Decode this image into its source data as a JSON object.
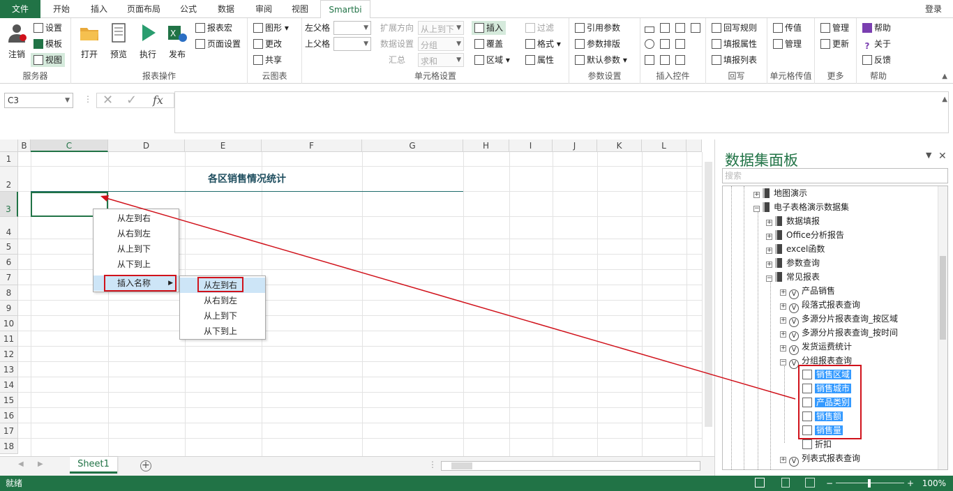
{
  "menu_tabs": [
    "文件",
    "开始",
    "插入",
    "页面布局",
    "公式",
    "数据",
    "审阅",
    "视图",
    "Smartbi"
  ],
  "login_label": "登录",
  "ribbon": {
    "server": {
      "label": "服务器",
      "login": "注销",
      "settings": "设置",
      "template": "模板",
      "view": "视图"
    },
    "report_ops": {
      "label": "报表操作",
      "open": "打开",
      "preview": "预览",
      "run": "执行",
      "publish": "发布",
      "macro": "报表宏",
      "page_setup": "页面设置"
    },
    "cloud": {
      "label": "云图表",
      "chart": "图形",
      "change": "更改",
      "share": "共享"
    },
    "cell_settings": {
      "label": "单元格设置",
      "left_parent": "左父格",
      "top_parent": "上父格",
      "expand_dir": "扩展方向",
      "expand_dir_value": "从上到下",
      "data_setting": "数据设置",
      "data_setting_value": "分组",
      "summary": "汇总",
      "summary_value": "求和",
      "insert": "插入",
      "cover": "覆盖",
      "area": "区域",
      "filter": "过滤",
      "format": "格式",
      "property": "属性"
    },
    "params": {
      "label": "参数设置",
      "ref_param": "引用参数",
      "param_layout": "参数排版",
      "default_param": "默认参数"
    },
    "controls": {
      "label": "插入控件"
    },
    "writeback": {
      "label": "回写",
      "rule": "回写规则",
      "fill_property": "填报属性",
      "fill_list": "填报列表"
    },
    "cell_passing": {
      "label": "单元格传值",
      "pass": "传值",
      "manage": "管理"
    },
    "more": {
      "label": "更多",
      "manage": "管理",
      "update": "更新"
    },
    "help": {
      "label": "帮助",
      "help": "帮助",
      "about": "关于",
      "feedback": "反馈"
    }
  },
  "formula_bar": {
    "name_box": "C3",
    "fx": "fx"
  },
  "sheet": {
    "columns": [
      "B",
      "C",
      "D",
      "E",
      "F",
      "G",
      "H",
      "I",
      "J",
      "K",
      "L"
    ],
    "rows": [
      "1",
      "2",
      "3",
      "4",
      "5",
      "6",
      "7",
      "8",
      "9",
      "10",
      "11",
      "12",
      "13",
      "14",
      "15",
      "16",
      "17",
      "18"
    ],
    "title": "各区销售情况统计"
  },
  "context_menu": {
    "items": [
      "从左到右",
      "从右到左",
      "从上到下",
      "从下到上"
    ],
    "insert_name": "插入名称",
    "submenu": [
      "从左到右",
      "从右到左",
      "从上到下",
      "从下到上"
    ]
  },
  "sheet_tab": "Sheet1",
  "status_text": "就绪",
  "zoom": "100%",
  "panel": {
    "title": "数据集面板",
    "search_placeholder": "搜索",
    "tree": [
      {
        "label": "地图演示"
      },
      {
        "label": "电子表格演示数据集"
      },
      {
        "label": "数据填报"
      },
      {
        "label": "Office分析报告"
      },
      {
        "label": "excel函数"
      },
      {
        "label": "参数查询"
      },
      {
        "label": "常见报表"
      },
      {
        "label": "产品销售"
      },
      {
        "label": "段落式报表查询"
      },
      {
        "label": "多源分片报表查询_按区域"
      },
      {
        "label": "多源分片报表查询_按时间"
      },
      {
        "label": "发货运费统计"
      },
      {
        "label": "分组报表查询"
      },
      {
        "label": "销售区域"
      },
      {
        "label": "销售城市"
      },
      {
        "label": "产品类别"
      },
      {
        "label": "销售额"
      },
      {
        "label": "销售量"
      },
      {
        "label": "折扣"
      },
      {
        "label": "列表式报表查询"
      }
    ]
  },
  "colors": {
    "excel_green": "#217346",
    "selection_blue": "#3399ff",
    "annotation_red": "#d0121b"
  }
}
